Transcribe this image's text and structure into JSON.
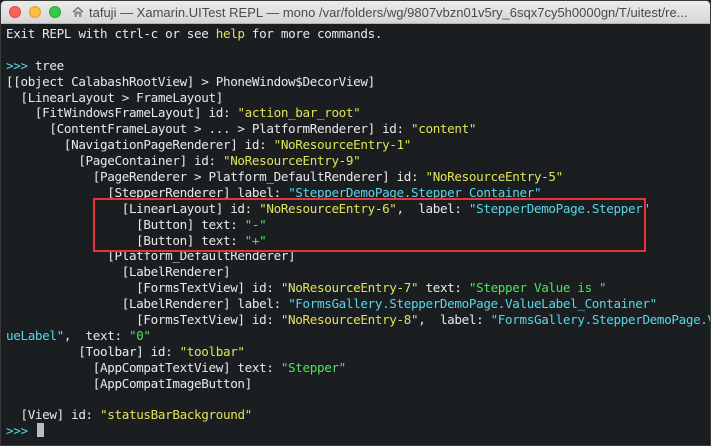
{
  "window": {
    "title": "tafuji — Xamarin.UITest REPL — mono /var/folders/wg/9807vbzn01v5ry_6sqx7cy5h0000gn/T/uitest/re..."
  },
  "terminal": {
    "intro_a": "Exit REPL with ctrl-c or see ",
    "intro_help": "help",
    "intro_b": " for more commands.",
    "prompt": ">>> ",
    "command": "tree",
    "lines": {
      "l1": "[[object CalabashRootView] > PhoneWindow$DecorView]",
      "l2": "  [LinearLayout > FrameLayout]",
      "l3a": "    [FitWindowsFrameLayout] id: ",
      "l3b": "\"action_bar_root\"",
      "l4a": "      [ContentFrameLayout > ... > PlatformRenderer] id: ",
      "l4b": "\"content\"",
      "l5a": "        [NavigationPageRenderer] id: ",
      "l5b": "\"NoResourceEntry-1\"",
      "l6a": "          [PageContainer] id: ",
      "l6b": "\"NoResourceEntry-9\"",
      "l7a": "            [PageRenderer > Platform_DefaultRenderer] id: ",
      "l7b": "\"NoResourceEntry-5\"",
      "l8a": "              [StepperRenderer] label: ",
      "l8b": "\"StepperDemoPage.Stepper_Container\"",
      "l9a": "                [LinearLayout] id: ",
      "l9b": "\"NoResourceEntry-6\"",
      "l9c": ",  label: ",
      "l9d": "\"StepperDemoPage.Stepper\"",
      "l10a": "                  [Button] text: ",
      "l10b": "\"-\"",
      "l11a": "                  [Button] text: ",
      "l11b": "\"+\"",
      "l12": "              [Platform_DefaultRenderer]",
      "l13": "                [LabelRenderer]",
      "l14a": "                  [FormsTextView] id: ",
      "l14b": "\"NoResourceEntry-7\"",
      "l14c": " text: ",
      "l14d": "\"Stepper Value is \"",
      "l15a": "                [LabelRenderer] label: ",
      "l15b": "\"FormsGallery.StepperDemoPage.ValueLabel_Container\"",
      "l16a": "                  [FormsTextView] id: ",
      "l16b": "\"NoResourceEntry-8\"",
      "l16c": ",  label: ",
      "l16d": "\"FormsGallery.StepperDemoPage.Val",
      "l17a": "ueLabel\"",
      "l17b": ",  text: ",
      "l17c": "\"0\"",
      "l18a": "          [Toolbar] id: ",
      "l18b": "\"toolbar\"",
      "l19a": "            [AppCompatTextView] text: ",
      "l19b": "\"Stepper\"",
      "l20": "            [AppCompatImageButton]",
      "l21a": "  [View] id: ",
      "l21b": "\"statusBarBackground\""
    }
  },
  "colors": {
    "background": "#1b1e21",
    "keyword_yellow": "#dfe35a",
    "string_green": "#4fe35a",
    "label_cyan": "#58d7e6",
    "highlight_red": "#e8323c"
  },
  "icons": {
    "title": "home-folder-icon"
  }
}
